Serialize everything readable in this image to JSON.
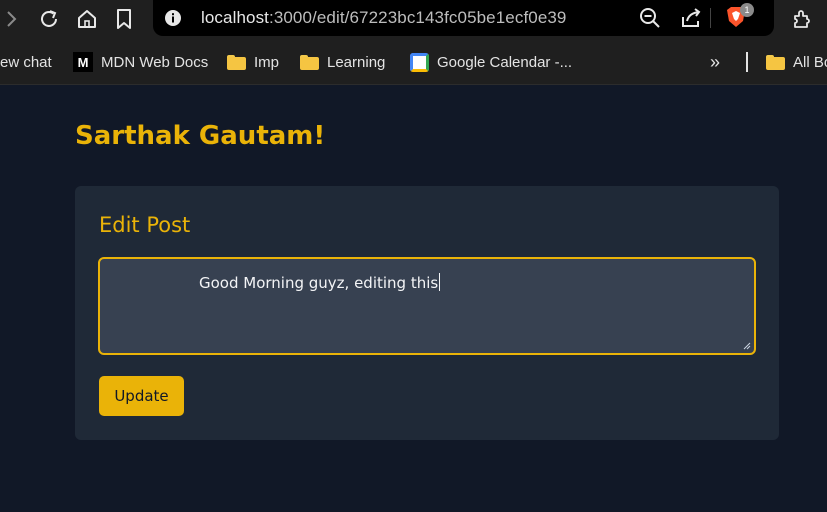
{
  "browser": {
    "url_host": "localhost",
    "url_path": ":3000/edit/67223bc143fc05be1ecf0e39",
    "extension_badge": "1",
    "icons": [
      "forward-icon",
      "reload-icon",
      "home-icon",
      "bookmark-icon",
      "info-icon",
      "zoom-out-icon",
      "share-icon",
      "brave-shield-icon",
      "extensions-icon"
    ]
  },
  "bookmarks": {
    "items": [
      {
        "label": "ew chat",
        "icon": "none"
      },
      {
        "label": "MDN Web Docs",
        "icon": "mdn-icon"
      },
      {
        "label": "Imp",
        "icon": "folder-icon"
      },
      {
        "label": "Learning",
        "icon": "folder-icon"
      },
      {
        "label": "Google Calendar -...",
        "icon": "google-calendar-icon"
      },
      {
        "label": "All Bo",
        "icon": "folder-icon"
      }
    ],
    "overflow_label": "»"
  },
  "app": {
    "username_heading": "Sarthak Gautam!",
    "form_title": "Edit Post",
    "textarea_value": "Good Morning guyz, editing this",
    "update_label": "Update",
    "accent_color": "#eab308"
  }
}
